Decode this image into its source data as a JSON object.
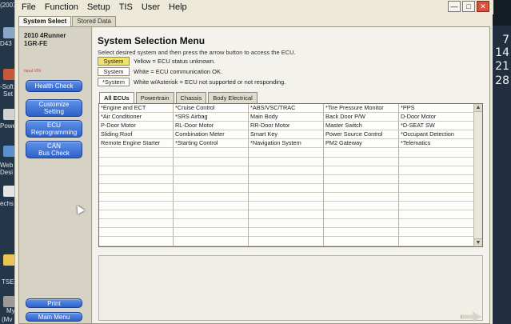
{
  "desktop": {
    "left_labels": [
      "(2007",
      "D43",
      "-Soft",
      "Set",
      "Powe",
      "Web",
      "Desi",
      "echs",
      "TSE",
      "My",
      "(Mv"
    ],
    "right_numbers": [
      "7",
      "14",
      "21",
      "28"
    ]
  },
  "menubar": {
    "items": [
      "File",
      "Function",
      "Setup",
      "TIS",
      "User",
      "Help"
    ]
  },
  "app_tabs": [
    "System Select",
    "Stored Data"
  ],
  "sidebar": {
    "vehicle_line1": "2010 4Runner",
    "vehicle_line2": "1GR-FE",
    "note": "Input VIN",
    "buttons": {
      "health_check": "Health Check",
      "customize_line1": "Customize",
      "customize_line2": "Setting",
      "ecu_line1": "ECU",
      "ecu_line2": "Reprogramming",
      "can_line1": "CAN",
      "can_line2": "Bus Check",
      "print": "Print",
      "main_menu": "Main Menu"
    }
  },
  "main": {
    "title": "System Selection Menu",
    "subtitle": "Select desired system and then press the arrow button to access the ECU.",
    "legend": [
      {
        "chip": "System",
        "text": "Yellow = ECU status unknown.",
        "color": "#f1e36a"
      },
      {
        "chip": "System",
        "text": "White = ECU communication OK.",
        "color": "#ffffff"
      },
      {
        "chip": "*System",
        "text": "White w/Asterisk = ECU not supported or not responding.",
        "color": "#ffffff"
      }
    ],
    "ecu_tabs": [
      "All ECUs",
      "Powertrain",
      "Chassis",
      "Body Electrical"
    ],
    "ecu_rows": [
      [
        "*Engine and ECT",
        "*Cruise Control",
        "*ABS/VSC/TRAC",
        "*Tire Pressure Monitor",
        "*PPS"
      ],
      [
        "*Air Conditioner",
        "*SRS Airbag",
        "Main Body",
        "Back Door P/W",
        "D-Door Motor"
      ],
      [
        "P-Door Motor",
        "RL-Door Motor",
        "RR-Door Motor",
        "Master Switch",
        "*D-SEAT SW"
      ],
      [
        "Sliding Roof",
        "Combination Meter",
        "Smart Key",
        "Power Source Control",
        "*Occupant Detection"
      ],
      [
        "Remote Engine Starter",
        "*Starting Control",
        "*Navigation System",
        "PM2 Gateway",
        "*Telematics"
      ]
    ]
  }
}
